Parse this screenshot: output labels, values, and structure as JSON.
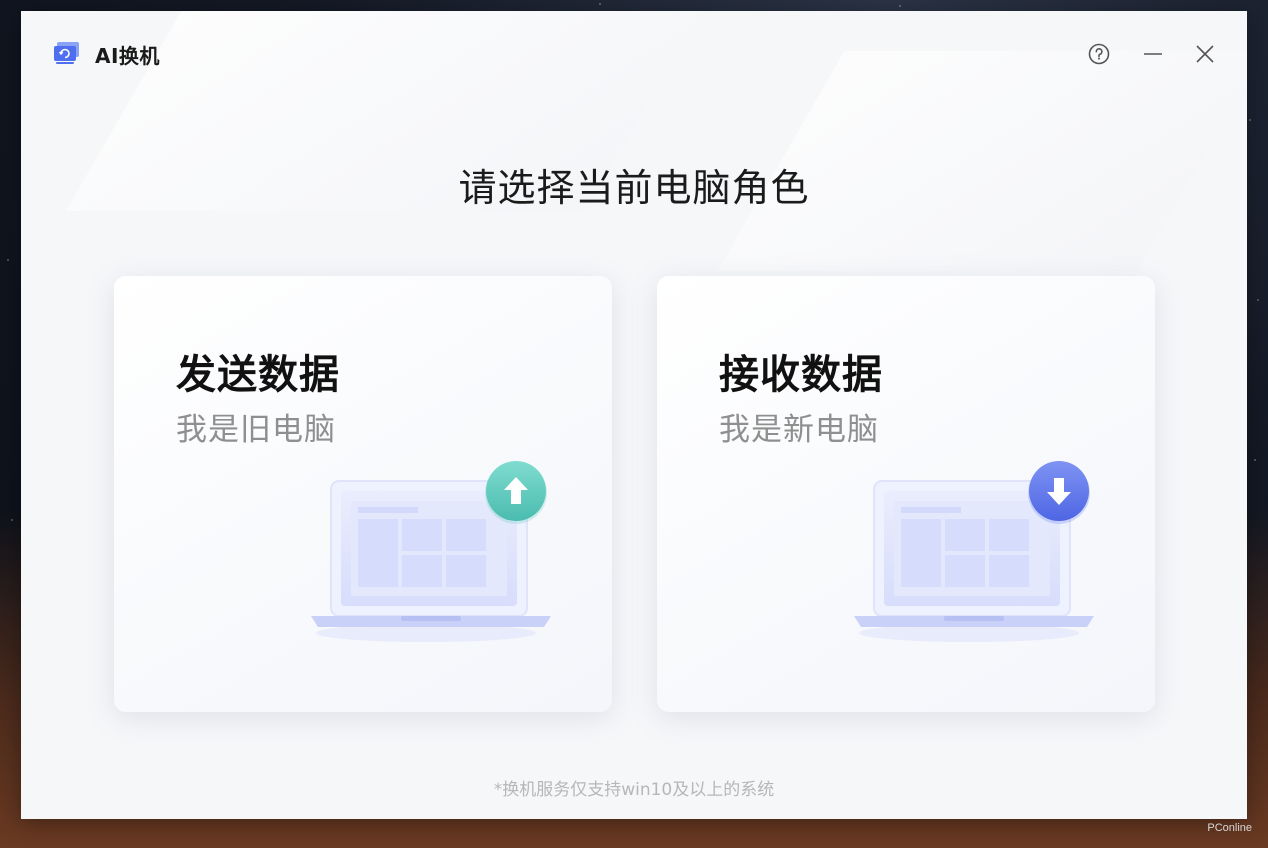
{
  "app": {
    "title": "AI换机",
    "icon": "screen-swap-icon",
    "accent": "#5b74f0"
  },
  "window_controls": {
    "help_icon": "help-icon",
    "minimize_icon": "minimize-icon",
    "close_icon": "close-icon"
  },
  "main": {
    "heading": "请选择当前电脑角色"
  },
  "cards": [
    {
      "title": "发送数据",
      "subtitle": "我是旧电脑",
      "icon": "upload-arrow-icon",
      "badge_color": "#5ec9bd"
    },
    {
      "title": "接收数据",
      "subtitle": "我是新电脑",
      "icon": "download-arrow-icon",
      "badge_color": "#6179ea"
    }
  ],
  "footer": {
    "note": "*换机服务仅支持win10及以上的系统"
  },
  "watermark": "PConline"
}
